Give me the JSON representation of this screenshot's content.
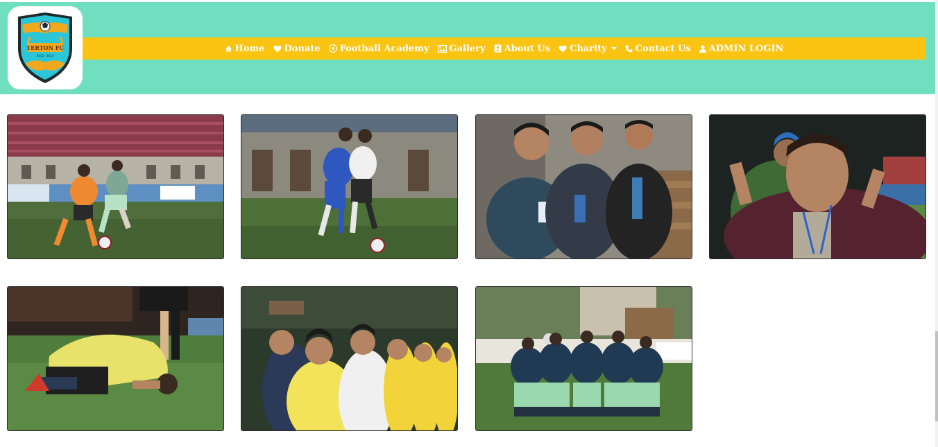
{
  "brand": {
    "name": "TERTON FC",
    "years": "2013 - 2014"
  },
  "nav": {
    "items": [
      {
        "label": "Home",
        "icon": "home-icon"
      },
      {
        "label": "Donate",
        "icon": "heart-icon"
      },
      {
        "label": "Football Academy",
        "icon": "soccer-ball-icon"
      },
      {
        "label": "Gallery",
        "icon": "image-icon"
      },
      {
        "label": "About Us",
        "icon": "address-book-icon"
      },
      {
        "label": "Charity",
        "icon": "heart-icon",
        "dropdown": true
      },
      {
        "label": "Contact Us",
        "icon": "phone-icon"
      },
      {
        "label": "ADMIN LOGIN",
        "icon": "user-icon"
      }
    ]
  },
  "gallery": {
    "photos": [
      {
        "subject": "youth players in orange and mint kits contesting the ball"
      },
      {
        "subject": "players in blue and white kits tackling for the ball"
      },
      {
        "subject": "three officials seated in the stands smiling"
      },
      {
        "subject": "man in maroon jacket pointing to his head"
      },
      {
        "subject": "player in yellow kit kneeling on the pitch"
      },
      {
        "subject": "players in yellow and white kits lining up"
      },
      {
        "subject": "team in navy and mint kits huddling on the pitch"
      }
    ]
  },
  "colors": {
    "header_bg": "#6fdfbf",
    "nav_bg": "#fbc413",
    "nav_text": "#ffffff"
  }
}
